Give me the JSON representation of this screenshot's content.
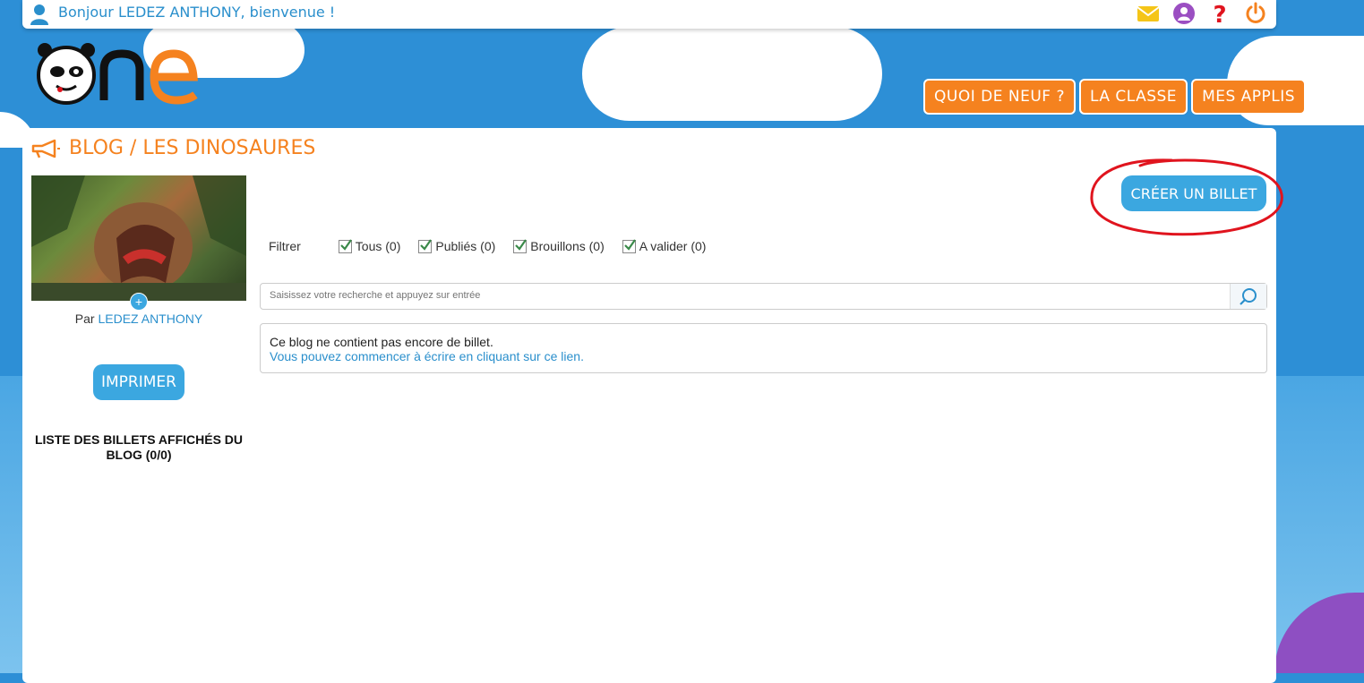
{
  "header": {
    "greeting": "Bonjour LEDEZ ANTHONY, bienvenue !"
  },
  "nav": {
    "items": [
      {
        "label": "QUOI DE NEUF ?"
      },
      {
        "label": "LA CLASSE"
      },
      {
        "label": "MES APPLIS"
      }
    ]
  },
  "page": {
    "title": "BLOG / LES DINOSAURES"
  },
  "sidebar": {
    "author_prefix": "Par",
    "author_name": "LEDEZ ANTHONY",
    "cover_add": "+",
    "print_label": "IMPRIMER",
    "list_title": "LISTE DES BILLETS AFFICHÉS DU BLOG (0/0)"
  },
  "main": {
    "create_label": "CRÉER UN BILLET",
    "filter_label": "Filtrer",
    "filters": [
      {
        "label": "Tous (0)",
        "checked": true
      },
      {
        "label": "Publiés (0)",
        "checked": true
      },
      {
        "label": "Brouillons (0)",
        "checked": true
      },
      {
        "label": "A valider (0)",
        "checked": true
      }
    ],
    "search_placeholder": "Saisissez votre recherche et appuyez sur entrée",
    "empty_message": "Ce blog ne contient pas encore de billet.",
    "empty_link": "Vous pouvez commencer à écrire en cliquant sur ce lien."
  },
  "colors": {
    "brand_orange": "#f5821f",
    "brand_blue": "#3ba7e0",
    "annotation_red": "#e0141e"
  }
}
